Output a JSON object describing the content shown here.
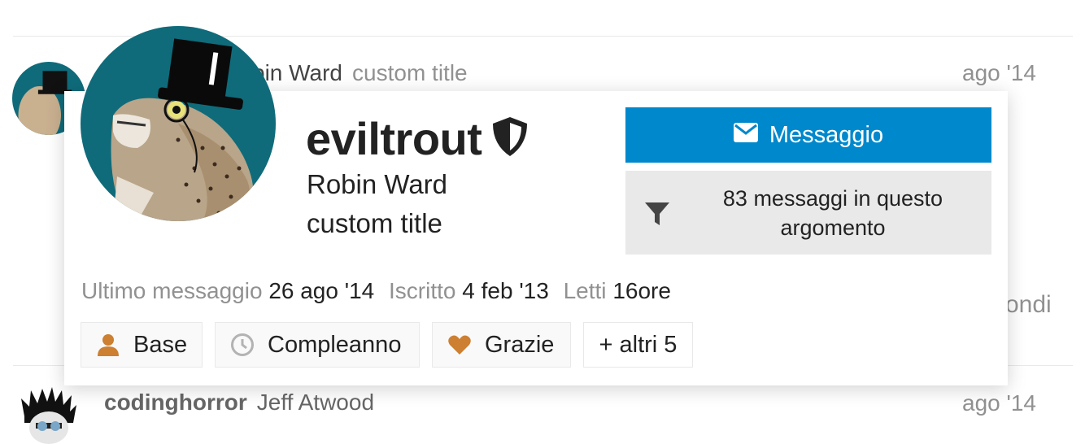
{
  "background_post": {
    "name_fragment": "bin Ward",
    "user_title": "custom title",
    "date": "ago '14",
    "text_fragment": "ondi"
  },
  "next_post": {
    "username": "codinghorror",
    "full_name": "Jeff Atwood",
    "date": "ago '14"
  },
  "user_card": {
    "username": "eviltrout",
    "name": "Robin Ward",
    "title": "custom title",
    "message_button": "Messaggio",
    "filter_button": "83 messaggi in questo argomento",
    "stats": {
      "last_post_label": "Ultimo messaggio",
      "last_post_value": "26 ago '14",
      "joined_label": "Iscritto",
      "joined_value": "4 feb '13",
      "read_label": "Letti",
      "read_value": "16ore"
    },
    "badges": [
      {
        "label": "Base",
        "icon": "user-icon",
        "color": "#cd7f32"
      },
      {
        "label": "Compleanno",
        "icon": "clock-icon",
        "color": "#b3b3b3"
      },
      {
        "label": "Grazie",
        "icon": "heart-icon",
        "color": "#cd7f32"
      }
    ],
    "more_badges": "+ altri 5"
  },
  "colors": {
    "primary": "#0088cc",
    "muted_text": "#919191",
    "bronze": "#cd7f32"
  }
}
